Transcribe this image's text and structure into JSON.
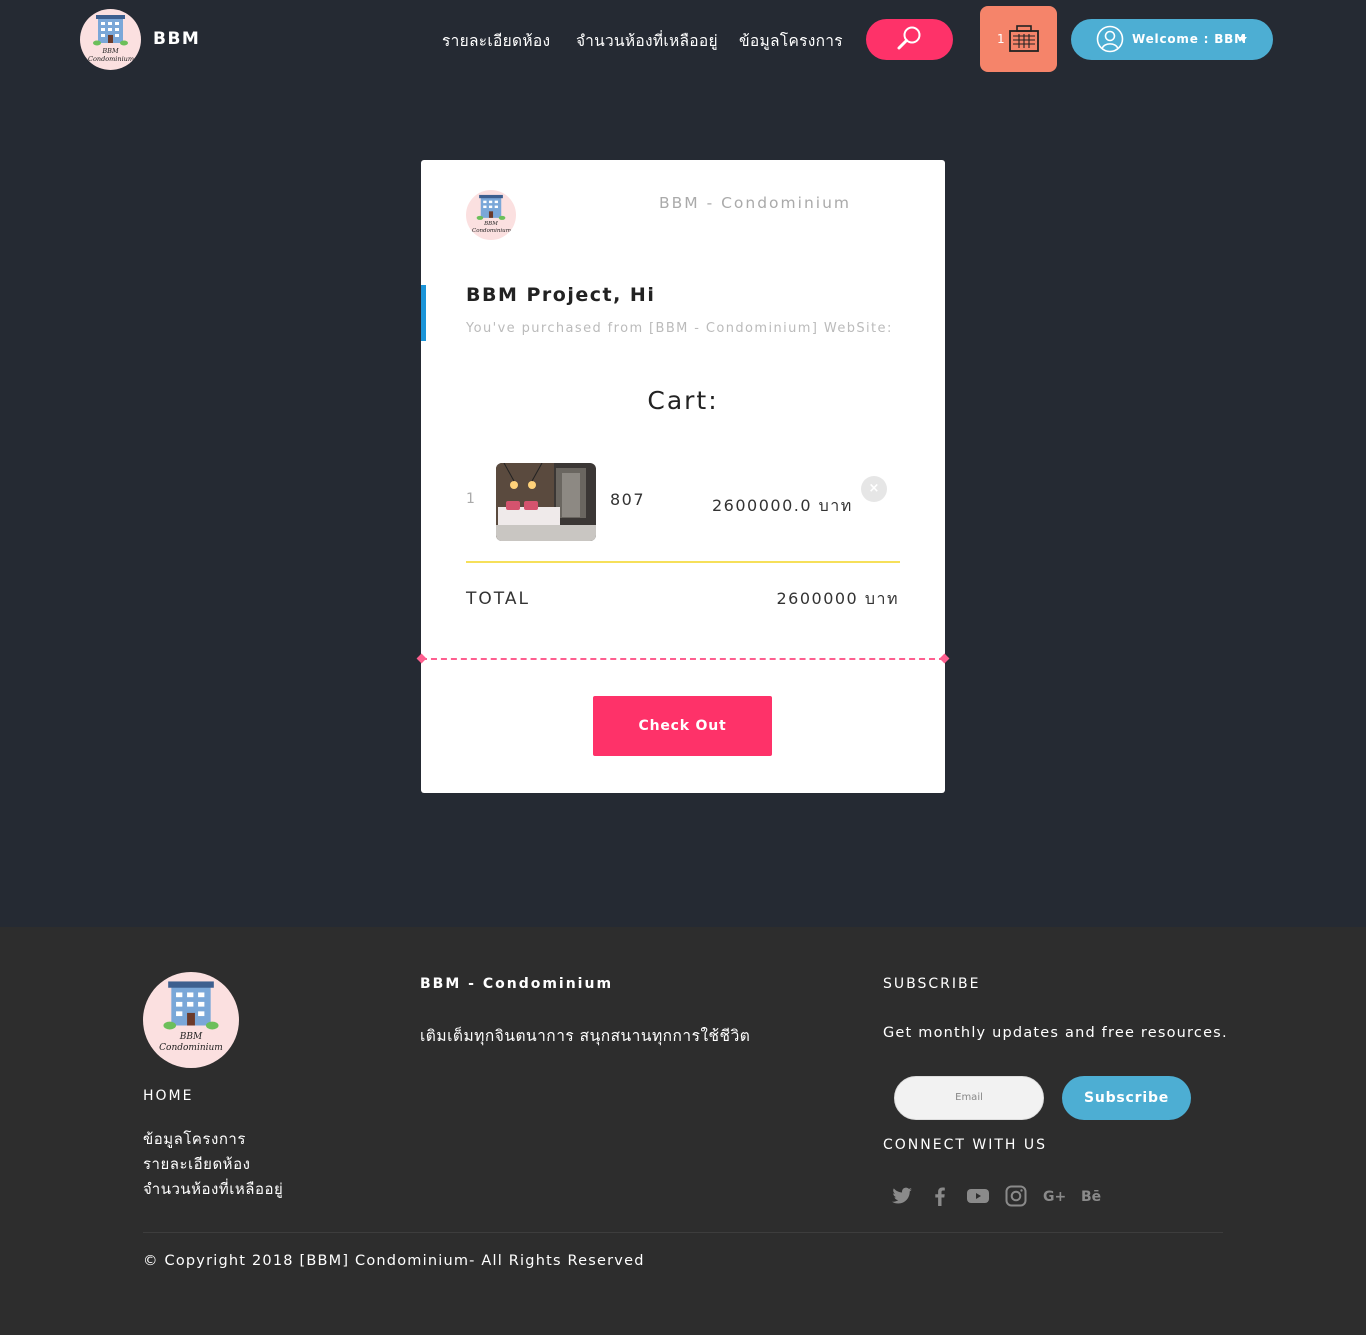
{
  "nav": {
    "brand": "BBM",
    "links": [
      "รายละเอียดห้อง",
      "จำนวนห้องที่เหลืออยู่",
      "ข้อมูลโครงการ"
    ],
    "cart_count": "1",
    "welcome": "Welcome : BBM",
    "logo_text": "BBM Condominium"
  },
  "card": {
    "site_name": "BBM - Condominium",
    "greeting": "BBM Project, Hi",
    "purchased_text": "You've purchased from [BBM - Condominium] WebSite:",
    "cart_title": "Cart:",
    "item": {
      "index": "1",
      "room": "807",
      "price": "2600000.0 บาท",
      "remove": "×"
    },
    "total_label": "TOTAL",
    "total_value": "2600000 บาท",
    "checkout_label": "Check Out"
  },
  "footer": {
    "home": "HOME",
    "links": [
      "ข้อมูลโครงการ",
      "รายละเอียดห้อง",
      "จำนวนห้องที่เหลืออยู่"
    ],
    "col_title": "BBM - Condominium",
    "tagline": "เติมเต็มทุกจินตนาการ สนุกสนานทุกการใช้ชีวิต",
    "subscribe_title": "SUBSCRIBE",
    "subscribe_text": "Get monthly updates and free resources.",
    "email_placeholder": "Email",
    "subscribe_button": "Subscribe",
    "connect_title": "CONNECT WITH US",
    "social_icons": [
      "twitter-icon",
      "facebook-icon",
      "youtube-icon",
      "instagram-icon",
      "google-plus-icon",
      "behance-icon"
    ],
    "copyright": "© Copyright 2018 [BBM] Condominium- All Rights Reserved"
  },
  "colors": {
    "background": "#252a33",
    "footer": "#2d2d2d",
    "accent_pink": "#fe3269",
    "accent_blue": "#4daed3",
    "cart_orange": "#f5846a"
  }
}
